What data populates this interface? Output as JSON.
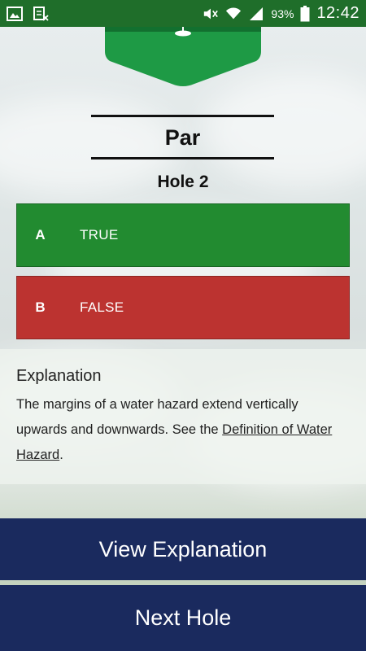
{
  "status_bar": {
    "battery_percent": "93%",
    "time": "12:42",
    "icons": [
      "gallery-icon",
      "screenshot-icon",
      "mute-icon",
      "wifi-icon",
      "signal-icon",
      "battery-icon"
    ]
  },
  "header": {
    "title": "Par",
    "hole": "Hole 2"
  },
  "options": [
    {
      "letter": "A",
      "label": "TRUE",
      "color": "#228b30"
    },
    {
      "letter": "B",
      "label": "FALSE",
      "color": "#bc3330"
    }
  ],
  "explanation": {
    "heading": "Explanation",
    "text_before": "The margins of a water hazard extend vertically upwards and downwards. See the ",
    "link_text": "Definition of Water Hazard",
    "text_after": "."
  },
  "buttons": {
    "view_explanation": "View Explanation",
    "next_hole": "Next Hole"
  },
  "colors": {
    "status_bar": "#1f6e2a",
    "badge_green": "#22a04a",
    "button_navy": "#1a2a5e"
  }
}
